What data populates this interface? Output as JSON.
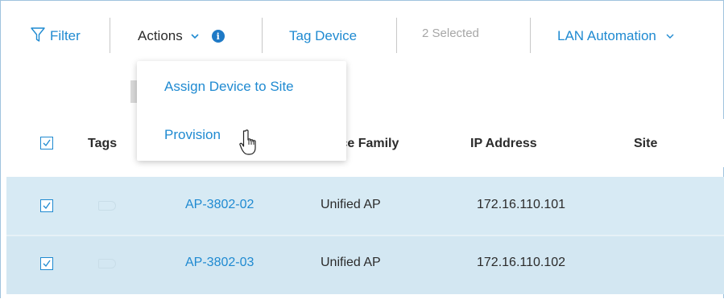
{
  "toolbar": {
    "filter_label": "Filter",
    "actions_label": "Actions",
    "tag_device_label": "Tag Device",
    "selected_text": "2 Selected",
    "lan_automation_label": "LAN Automation"
  },
  "actions_menu": {
    "items": [
      {
        "label": "Assign Device to Site"
      },
      {
        "label": "Provision"
      }
    ]
  },
  "table": {
    "headers": {
      "tags": "Tags",
      "device_family": "ice Family",
      "ip_address": "IP Address",
      "site": "Site"
    },
    "rows": [
      {
        "checked": true,
        "device_name": "AP-3802-02",
        "device_family": "Unified AP",
        "ip_address": "172.16.110.101"
      },
      {
        "checked": true,
        "device_name": "AP-3802-03",
        "device_family": "Unified AP",
        "ip_address": "172.16.110.102"
      }
    ]
  },
  "colors": {
    "accent": "#1f8ad1",
    "selected_row_bg": "#d7eaf4",
    "info_icon": "#1f7ac6"
  },
  "icons": [
    "filter-icon",
    "chevron-down-icon",
    "info-icon",
    "checkbox-checked-icon",
    "tag-icon",
    "hand-pointer-cursor-icon"
  ]
}
